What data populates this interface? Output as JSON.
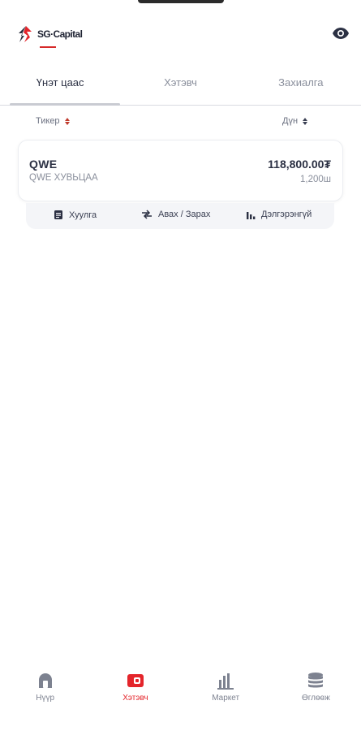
{
  "header": {
    "logo_text": "SG·Capital",
    "eye_icon": "eye-icon"
  },
  "tabs": [
    {
      "label": "Үнэт цаас",
      "active": true
    },
    {
      "label": "Хэтэвч",
      "active": false
    },
    {
      "label": "Захиалга",
      "active": false
    }
  ],
  "sort": {
    "ticker_label": "Тикер",
    "amount_label": "Дүн"
  },
  "holding": {
    "ticker": "QWE",
    "company": "QWE ХУВЬЦАА",
    "amount": "118,800.00₮",
    "quantity": "1,200ш"
  },
  "actions": [
    {
      "label": "Хуулга",
      "icon": "statement-icon"
    },
    {
      "label": "Авах / Зарах",
      "icon": "swap-icon"
    },
    {
      "label": "Дэлгэрэнгүй",
      "icon": "bar-chart-icon"
    }
  ],
  "bottom_nav": [
    {
      "label": "Нүүр",
      "icon": "home-icon",
      "active": false
    },
    {
      "label": "Хэтэвч",
      "icon": "wallet-icon",
      "active": true
    },
    {
      "label": "Маркет",
      "icon": "market-chart-icon",
      "active": false
    },
    {
      "label": "Өглөөж",
      "icon": "coins-icon",
      "active": false
    }
  ],
  "colors": {
    "accent": "#e4252b",
    "text_primary": "#2b3043",
    "text_secondary": "#8a8f9c"
  }
}
